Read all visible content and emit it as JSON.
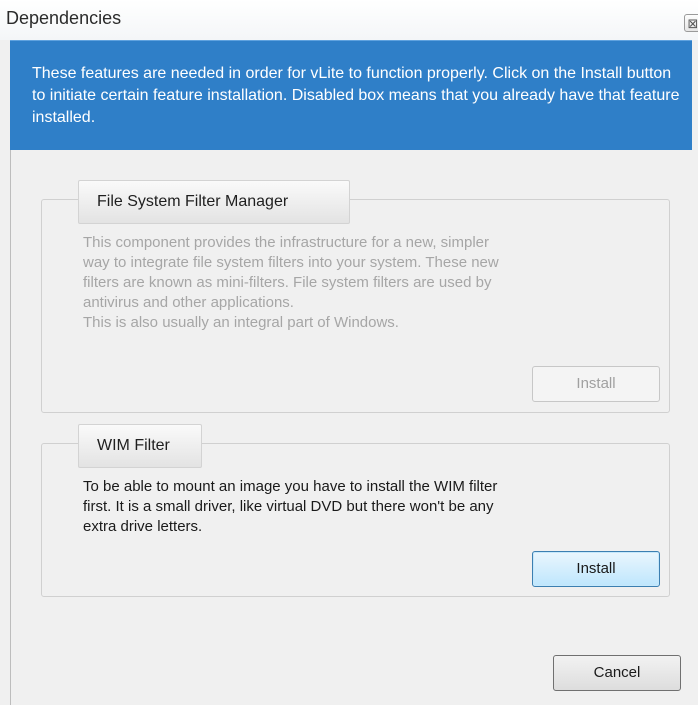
{
  "window": {
    "title": "Dependencies",
    "close_glyph": "⊠"
  },
  "banner": {
    "text": "These features are needed in order for vLite to function properly. Click on the Install button to initiate certain feature installation. Disabled box means that you already have that feature installed.",
    "color": "#2f7fc8"
  },
  "features": [
    {
      "title": "File System Filter Manager",
      "description_lines": [
        "This component provides the infrastructure for a new, simpler",
        "way to integrate file system filters into your system. These new",
        "filters are known as mini-filters. File system filters are used by",
        "antivirus and other applications.",
        "This is also usually an integral part of Windows."
      ],
      "button_label": "Install",
      "enabled": false
    },
    {
      "title": "WIM Filter",
      "description_lines": [
        "To be able to mount an image you have to install the WIM filter",
        "first. It is a small driver, like virtual DVD but there won't be any",
        "extra drive letters."
      ],
      "button_label": "Install",
      "enabled": true
    }
  ],
  "footer": {
    "cancel_label": "Cancel"
  }
}
